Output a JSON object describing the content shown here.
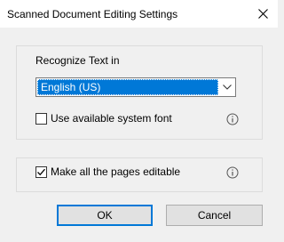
{
  "window": {
    "title": "Scanned Document Editing Settings",
    "close_icon": "close-icon"
  },
  "recognize": {
    "label": "Recognize Text in",
    "selected_language": "English (US)",
    "dropdown_icon": "chevron-down-icon"
  },
  "options": {
    "system_font": {
      "label": "Use available system font",
      "checked": false,
      "info_icon": "info-icon"
    },
    "editable": {
      "label": "Make all the pages editable",
      "checked": true,
      "info_icon": "info-icon"
    }
  },
  "buttons": {
    "ok_label": "OK",
    "cancel_label": "Cancel"
  },
  "colors": {
    "accent": "#0078d7",
    "background": "#f0f0f0",
    "titlebar": "#ffffff"
  }
}
